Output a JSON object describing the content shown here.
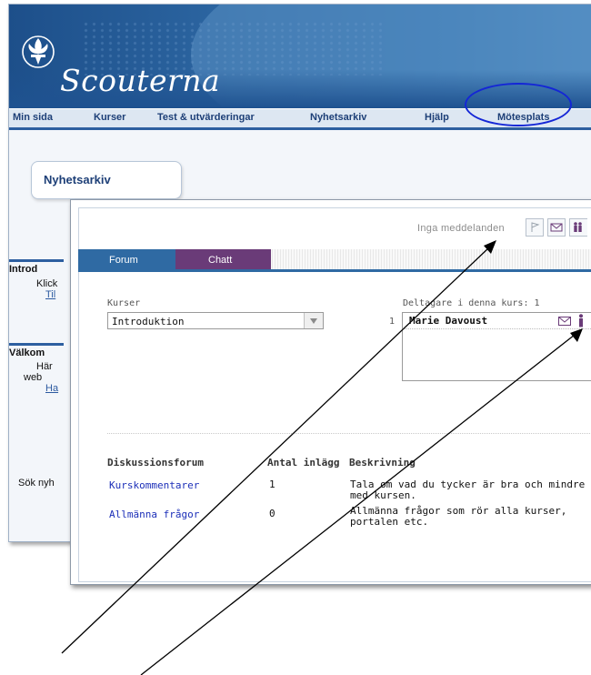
{
  "header": {
    "brand": "Scouterna"
  },
  "nav": {
    "items": [
      "Min sida",
      "Kurser",
      "Test & utvärderingar",
      "Nyhetsarkiv",
      "Hjälp",
      "Mötesplats"
    ]
  },
  "back_page": {
    "tab_title": "Nyhetsarkiv",
    "intro": {
      "heading": "Introd",
      "line1": "Klick",
      "link": "Til"
    },
    "welcome": {
      "heading": "Välkom",
      "line1": "Här",
      "line2": "web",
      "link": "Ha"
    },
    "search": "Sök nyh"
  },
  "meeting": {
    "messages": "Inga meddelanden",
    "tabs": {
      "forum": "Forum",
      "chat": "Chatt"
    },
    "courses": {
      "label": "Kurser",
      "selected": "Introduktion"
    },
    "participants": {
      "label": "Deltagare i denna kurs: 1",
      "number": "1",
      "name": "Marie Davoust"
    },
    "forum_table": {
      "headers": [
        "Diskussionsforum",
        "Antal inlägg",
        "Beskrivning"
      ],
      "rows": [
        {
          "name": "Kurskommentarer",
          "count": "1",
          "desc1": "Tala om vad du tycker är bra och mindre br",
          "desc2": "med kursen."
        },
        {
          "name": "Allmänna frågor",
          "count": "0",
          "desc1": "Allmänna frågor som rör alla kurser,",
          "desc2": "portalen etc."
        }
      ]
    }
  },
  "colors": {
    "nav_text": "#1d3f77",
    "forum_tab": "#2f6aa3",
    "chat_tab": "#6a3b78",
    "link": "#1c2fb8",
    "highlight_circle": "#1426d6"
  }
}
